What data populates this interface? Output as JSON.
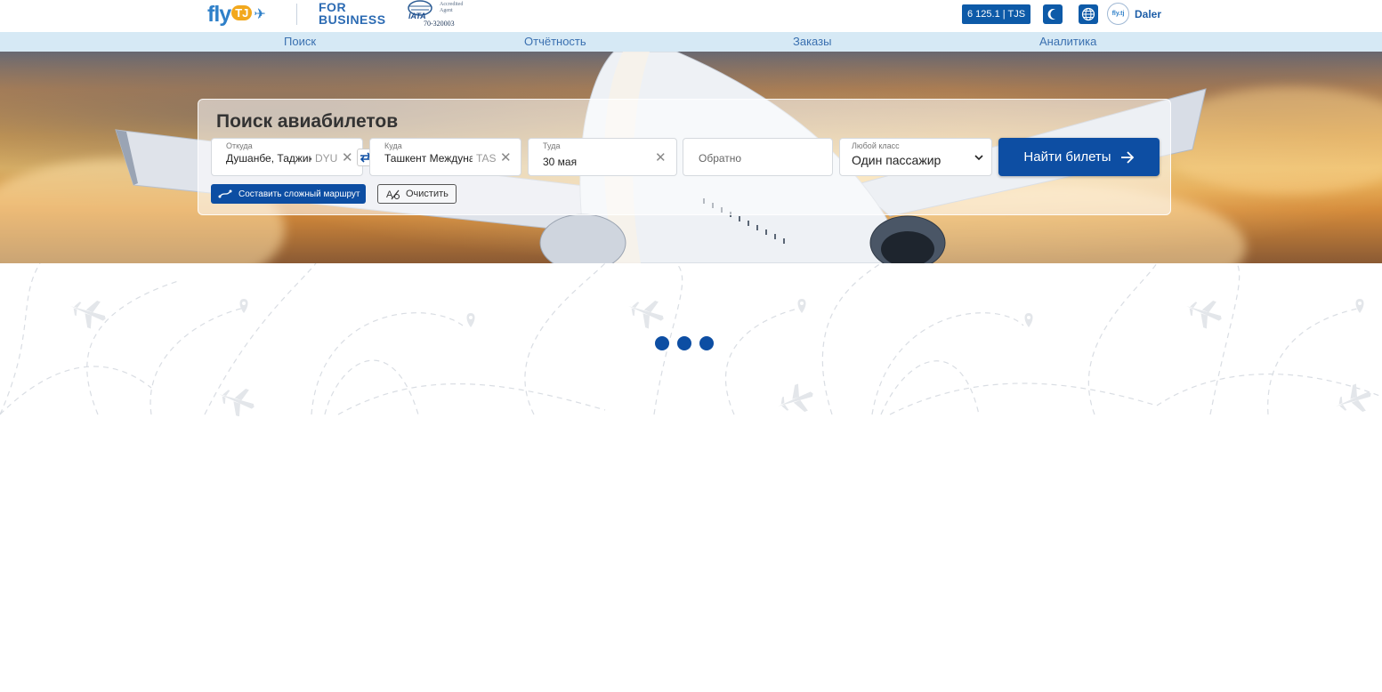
{
  "header": {
    "logo": {
      "fly": "fly",
      "tj": "TJ"
    },
    "for_business": [
      "FOR",
      "BUSINESS"
    ],
    "iata": {
      "text_lines": [
        "Accredited",
        "Agent"
      ],
      "number": "70-320003"
    },
    "balance": "6 125.1 | TJS",
    "avatar_text": "fly.tj",
    "username": "Daler"
  },
  "nav": {
    "items": [
      {
        "label": "Поиск"
      },
      {
        "label": "Отчётность"
      },
      {
        "label": "Заказы"
      },
      {
        "label": "Аналитика"
      }
    ]
  },
  "search": {
    "title": "Поиск авиабилетов",
    "from": {
      "label": "Откуда",
      "value": "Душанбе, Таджикистан",
      "code": "DYU"
    },
    "to": {
      "label": "Куда",
      "value": "Ташкент Международный",
      "code": "TAS"
    },
    "depart": {
      "label": "Туда",
      "value": "30 мая"
    },
    "return": {
      "placeholder": "Обратно"
    },
    "passengers": {
      "label": "Любой класс",
      "value": "Один пассажир"
    },
    "find_label": "Найти билеты",
    "route_label": "Составить сложный маршрут",
    "clear_label": "Очистить"
  },
  "colors": {
    "brand_blue": "#0d4ea3",
    "nav_bg": "#d6e9f5",
    "accent_orange": "#f2a81d"
  }
}
